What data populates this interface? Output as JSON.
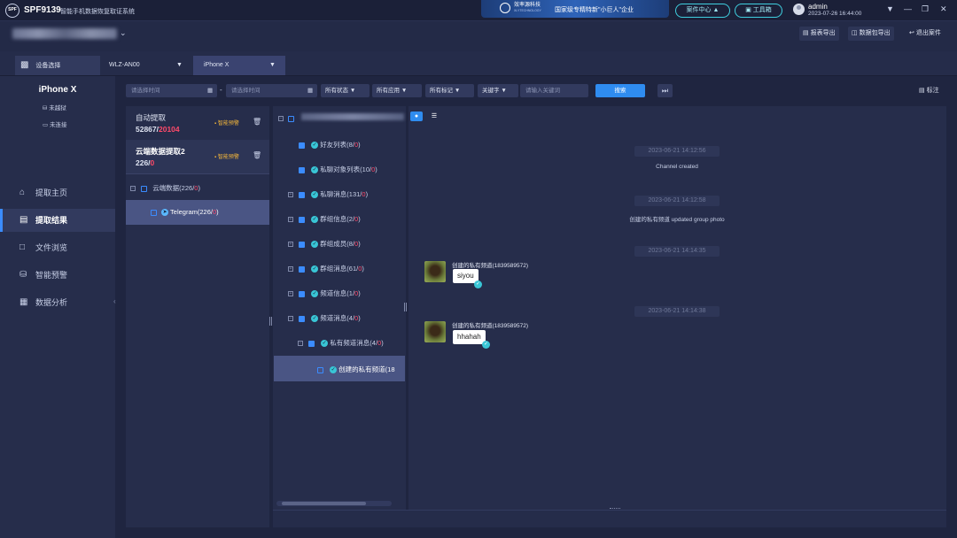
{
  "titlebar": {
    "logo_text": "SPF",
    "app_code": "SPF9139",
    "app_name": "智能手机数据恢复取证系统",
    "banner_brand": "效率源科技",
    "banner_sub": "XLYTECHNOLOGY",
    "banner_text": "国家级专精特新\"小巨人\"企业",
    "case_center": "案件中心",
    "toolbox": "工具箱",
    "user": "admin",
    "datetime": "2023-07-26 16:44:00"
  },
  "toolbar": {
    "report_export": "报表导出",
    "package_export": "数据包导出",
    "exit_case": "退出案件"
  },
  "device_bar": {
    "select_label": "设备选择",
    "device1": "WLZ-AN00",
    "device2": "iPhone X"
  },
  "sidebar": {
    "device_name": "iPhone X",
    "jailbreak": "未越狱",
    "connection": "未连接",
    "nav": [
      {
        "label": "提取主页",
        "icon": "home-icon"
      },
      {
        "label": "提取结果",
        "icon": "result-icon"
      },
      {
        "label": "文件浏览",
        "icon": "folder-icon"
      },
      {
        "label": "智能预警",
        "icon": "shield-icon"
      },
      {
        "label": "数据分析",
        "icon": "chart-icon"
      }
    ]
  },
  "filters": {
    "start_placeholder": "请选择时间",
    "end_placeholder": "请选择时间",
    "separator": "-",
    "status": "所有状态",
    "apps": "所有应用",
    "marks": "所有标记",
    "keyword_type": "关键字",
    "keyword_placeholder": "请输入关键词",
    "search": "搜索",
    "mark": "标注"
  },
  "sources": [
    {
      "title": "自动提取",
      "count_main": "52867/",
      "count_red": "20104",
      "badge": "智能预警"
    },
    {
      "title": "云端数据提取2",
      "count_main": "226/",
      "count_red": "0",
      "badge": "智能预警"
    }
  ],
  "source_tree": [
    {
      "label_main": "云端数据(226/",
      "label_red": "0",
      "label_end": ")"
    },
    {
      "label_main": "Telegram(226/",
      "label_red": "0",
      "label_end": ")"
    }
  ],
  "category_tree": [
    {
      "main": "好友列表(8/",
      "red": "0",
      "end": ")"
    },
    {
      "main": "私聊对象列表(10/",
      "red": "0",
      "end": ")"
    },
    {
      "main": "私聊消息(131/",
      "red": "0",
      "end": ")"
    },
    {
      "main": "群组信息(2/",
      "red": "0",
      "end": ")"
    },
    {
      "main": "群组成员(8/",
      "red": "0",
      "end": ")"
    },
    {
      "main": "群组消息(61/",
      "red": "0",
      "end": ")"
    },
    {
      "main": "频道信息(1/",
      "red": "0",
      "end": ")"
    },
    {
      "main": "频道消息(4/",
      "red": "0",
      "end": ")"
    },
    {
      "main": "私有频道消息(4/",
      "red": "0",
      "end": ")"
    },
    {
      "main": "创建的私有频道(18",
      "red": "",
      "end": ""
    }
  ],
  "messages": {
    "t1": "2023-06-21 14:12:56",
    "sys1": "Channel created",
    "t2": "2023-06-21 14:12:58",
    "sys2": "创建的私有频道 updated group photo",
    "t3": "2023-06-21 14:14:35",
    "sender1": "创建的私有频道(1839589572)",
    "text1": "siyou",
    "t4": "2023-06-21 14:14:38",
    "sender2": "创建的私有频道(1839589572)",
    "text2": "hhahah"
  }
}
